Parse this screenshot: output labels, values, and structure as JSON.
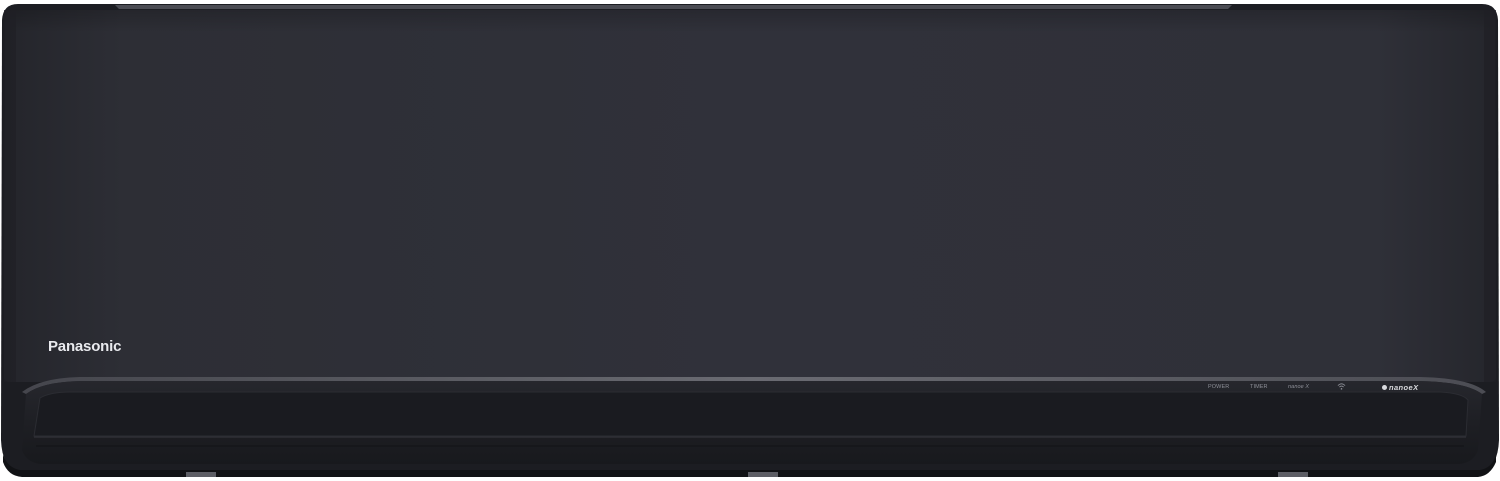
{
  "product": {
    "brand": "Panasonic",
    "indicators": {
      "power": "POWER",
      "timer": "TIMER",
      "nanoe": "nanoe X"
    },
    "wifi_icon": "wifi-icon",
    "nanoe_logo_text": "nanoeX"
  },
  "colors": {
    "body": "#2f3038",
    "panel_edge": "#5a5b62",
    "lower_trim": "#1c1d22",
    "text_light": "#e9eaee",
    "indicator_text": "#8d8f97"
  }
}
